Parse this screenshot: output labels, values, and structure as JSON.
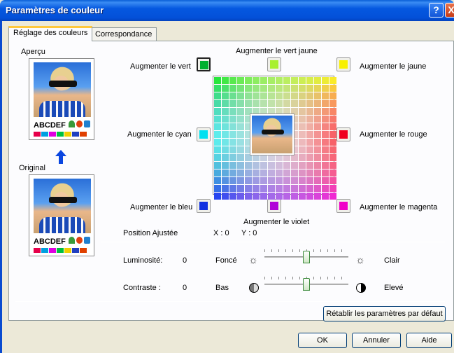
{
  "window": {
    "title": "Paramètres de couleur",
    "help_glyph": "?",
    "close_glyph": "X"
  },
  "tabs": [
    {
      "label": "Réglage des couleurs",
      "active": true
    },
    {
      "label": "Correspondance",
      "active": false
    }
  ],
  "left": {
    "preview_label": "Aperçu",
    "original_label": "Original",
    "sample_text": "ABCDEF",
    "swatch_colors": [
      "#e6004a",
      "#00a0e0",
      "#e000e0",
      "#00c040",
      "#f0d000",
      "#2040c0",
      "#e04000"
    ]
  },
  "adjust": {
    "vert_jaune": "Augmenter le vert jaune",
    "vert": "Augmenter le vert",
    "jaune": "Augmenter le jaune",
    "cyan": "Augmenter le cyan",
    "rouge": "Augmenter le rouge",
    "bleu": "Augmenter le bleu",
    "magenta": "Augmenter le magenta",
    "violet": "Augmenter le violet"
  },
  "colors": {
    "vert": "#00b030",
    "vert_jaune": "#a8f030",
    "jaune": "#f8f000",
    "cyan": "#00e0f0",
    "rouge": "#f00020",
    "bleu": "#1030e0",
    "magenta": "#f000c8",
    "violet": "#b000d8"
  },
  "position": {
    "label": "Position Ajustée",
    "x": "X : 0",
    "y": "Y : 0"
  },
  "luminosite": {
    "label": "Luminosité:",
    "value": "0",
    "min": "Foncé",
    "max": "Clair",
    "level": 0.5
  },
  "contraste": {
    "label": "Contraste :",
    "value": "0",
    "min": "Bas",
    "max": "Elevé",
    "level": 0.5
  },
  "buttons": {
    "reset": "Rétablir les paramètres par défaut",
    "ok": "OK",
    "cancel": "Annuler",
    "help": "Aide"
  }
}
